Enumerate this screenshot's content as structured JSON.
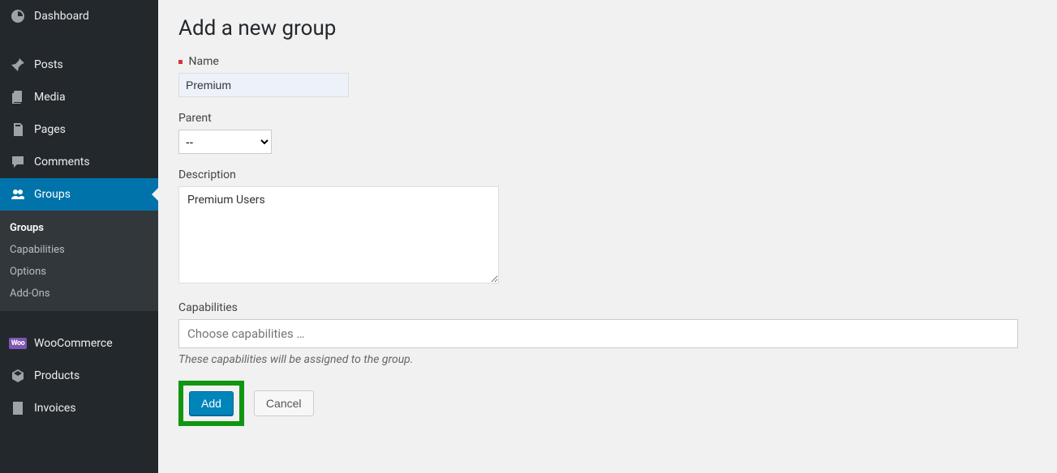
{
  "sidebar": {
    "items": [
      {
        "label": "Dashboard"
      },
      {
        "label": "Posts"
      },
      {
        "label": "Media"
      },
      {
        "label": "Pages"
      },
      {
        "label": "Comments"
      },
      {
        "label": "Groups"
      },
      {
        "label": "WooCommerce"
      },
      {
        "label": "Products"
      },
      {
        "label": "Invoices"
      }
    ],
    "submenu": [
      {
        "label": "Groups"
      },
      {
        "label": "Capabilities"
      },
      {
        "label": "Options"
      },
      {
        "label": "Add-Ons"
      }
    ]
  },
  "page": {
    "title": "Add a new group",
    "name_label": "Name",
    "name_value": "Premium",
    "parent_label": "Parent",
    "parent_value": "--",
    "description_label": "Description",
    "description_value": "Premium Users",
    "capabilities_label": "Capabilities",
    "capabilities_placeholder": "Choose capabilities …",
    "capabilities_hint": "These capabilities will be assigned to the group.",
    "add_button": "Add",
    "cancel_button": "Cancel"
  }
}
